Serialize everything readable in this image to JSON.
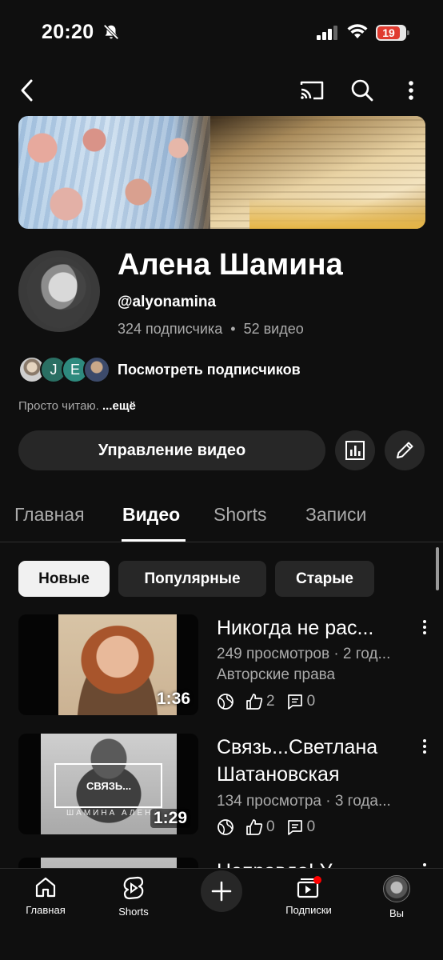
{
  "status_bar": {
    "time": "20:20",
    "battery": "19"
  },
  "channel": {
    "name": "Алена Шамина",
    "handle": "@alyonamina",
    "subscribers": "324 подписчика",
    "separator": "•",
    "videos": "52 видео",
    "view_subscribers": "Посмотреть подписчиков",
    "subscriber_initials": [
      "J",
      "E"
    ],
    "description": "Просто читаю.",
    "more": "...ещё",
    "manage_button": "Управление видео"
  },
  "tabs": [
    {
      "label": "Главная",
      "active": false
    },
    {
      "label": "Видео",
      "active": true
    },
    {
      "label": "Shorts",
      "active": false
    },
    {
      "label": "Записи",
      "active": false
    }
  ],
  "chips": [
    {
      "label": "Новые",
      "active": true
    },
    {
      "label": "Популярные",
      "active": false
    },
    {
      "label": "Старые",
      "active": false
    }
  ],
  "videos": [
    {
      "title": "Никогда не рас...",
      "meta": "249 просмотров · 2 год...",
      "license": "Авторские права",
      "likes": "2",
      "comments": "0",
      "duration": "1:36"
    },
    {
      "title": "Связь...Светлана Шатановская",
      "meta": "134 просмотра · 3 года...",
      "likes": "0",
      "comments": "0",
      "duration": "1:29",
      "thumb_text": "СВЯЗЬ...",
      "thumb_caption": "ШАМИНА АЛЕНА"
    },
    {
      "title": "Неправда! У..."
    }
  ],
  "bottom_nav": {
    "home": "Главная",
    "shorts": "Shorts",
    "subscriptions": "Подписки",
    "you": "Вы"
  },
  "colors": {
    "background": "#0f0f0f",
    "surface": "#272727",
    "secondary_text": "#aaaaaa",
    "notification_dot": "#ff0000",
    "battery": "#e03a2f"
  }
}
